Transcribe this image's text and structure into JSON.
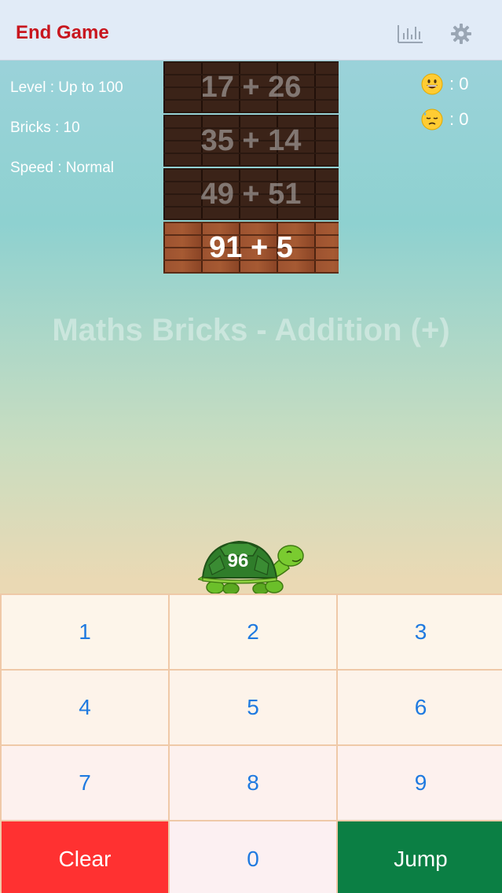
{
  "topbar": {
    "end_game_label": "End Game",
    "stats_icon": "bar-chart-icon",
    "settings_icon": "gear-icon"
  },
  "info": {
    "level": "Level : Up to 100",
    "bricks": "Bricks : 10",
    "speed": "Speed : Normal"
  },
  "scores": {
    "correct": ": 0",
    "wrong": ": 0"
  },
  "bricks": [
    "17 + 26",
    "35 + 14",
    "49 + 51",
    "91 + 5"
  ],
  "watermark": "Maths Bricks - Addition (+)",
  "turtle_value": "96",
  "keypad": {
    "keys": [
      "1",
      "2",
      "3",
      "4",
      "5",
      "6",
      "7",
      "8",
      "9",
      "Clear",
      "0",
      "Jump"
    ]
  },
  "colors": {
    "end_game": "#c8161e",
    "clear": "#ff3131",
    "jump": "#0b7f44",
    "digit": "#1f7ae0"
  }
}
